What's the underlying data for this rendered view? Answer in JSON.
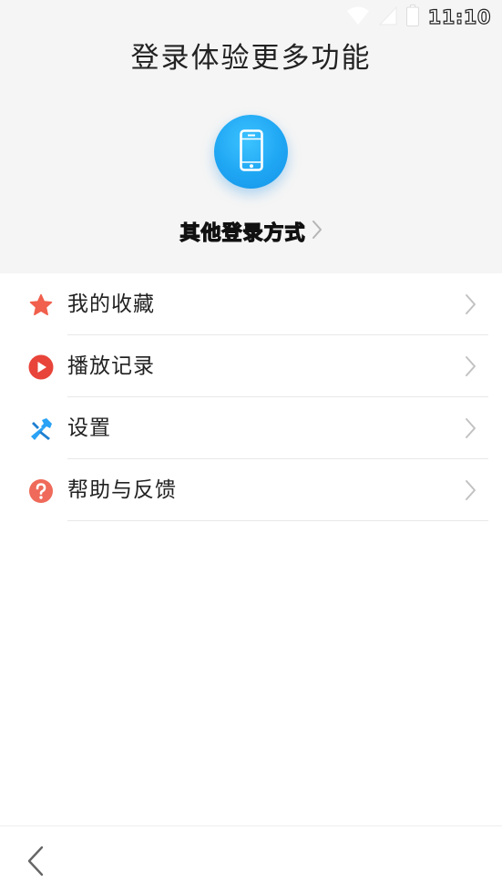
{
  "status_bar": {
    "time": "11:10",
    "icons": [
      "wifi-icon",
      "signal-icon",
      "battery-icon"
    ]
  },
  "header": {
    "title": "登录体验更多功能",
    "phone_login_icon": "smartphone-icon",
    "other_login_label": "其他登录方式"
  },
  "menu": {
    "items": [
      {
        "label": "我的收藏",
        "icon": "star-icon",
        "icon_color": "#f0604d"
      },
      {
        "label": "播放记录",
        "icon": "play-icon",
        "icon_color": "#e8443a"
      },
      {
        "label": "设置",
        "icon": "wrench-icon",
        "icon_color": "#2aa2f5"
      },
      {
        "label": "帮助与反馈",
        "icon": "help-icon",
        "icon_color": "#ef6a5a"
      }
    ]
  },
  "bottom_bar": {
    "back_icon": "back-arrow-icon"
  },
  "colors": {
    "header_bg": "#f5f5f5",
    "accent_blue": "#1fa6f3"
  }
}
